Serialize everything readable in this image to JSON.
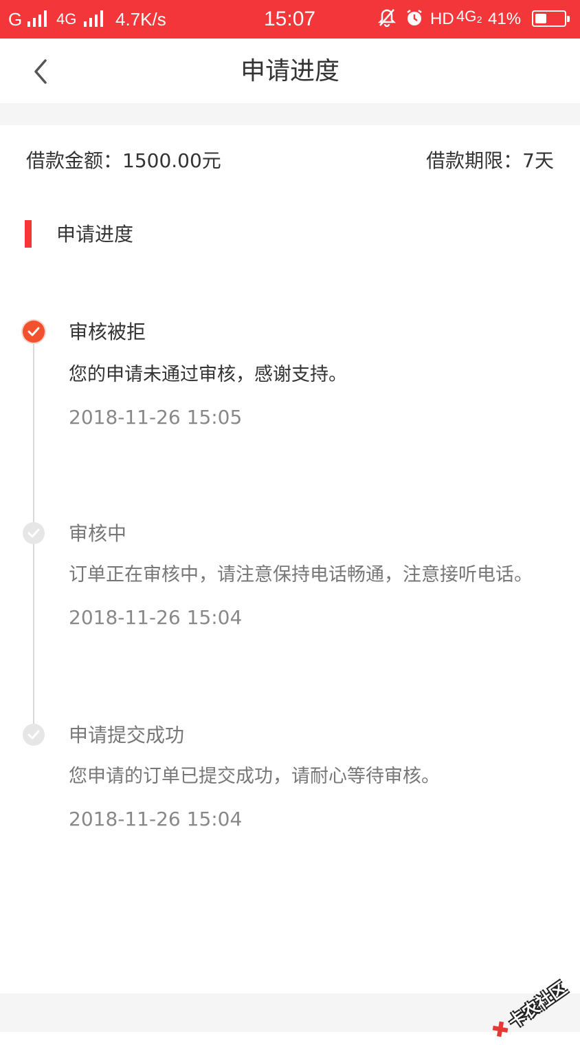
{
  "status_bar": {
    "carrier_left": "G",
    "network_2": "4G",
    "speed": "4.7K/s",
    "time": "15:07",
    "hd_label": "HD",
    "network_3": "4G₂",
    "battery_text": "41%",
    "battery_level": 0.41
  },
  "nav": {
    "back_icon": "chevron-left-icon",
    "title": "申请进度"
  },
  "loan": {
    "amount_text": "借款金额：1500.00元",
    "term_text": "借款期限：7天"
  },
  "section": {
    "title": "申请进度"
  },
  "timeline": [
    {
      "title": "审核被拒",
      "desc": "您的申请未通过审核，感谢支持。",
      "time": "2018-11-26 15:05",
      "state": "active"
    },
    {
      "title": "审核中",
      "desc": "订单正在审核中，请注意保持电话畅通，注意接听电话。",
      "time": "2018-11-26 15:04",
      "state": "done"
    },
    {
      "title": "申请提交成功",
      "desc": "您申请的订单已提交成功，请耐心等待审核。",
      "time": "2018-11-26 15:04",
      "state": "done"
    }
  ],
  "watermark": "卡农社区",
  "colors": {
    "accent": "#f2363a",
    "active_dot": "#f2512e",
    "inactive_dot": "#e6e6e6"
  }
}
